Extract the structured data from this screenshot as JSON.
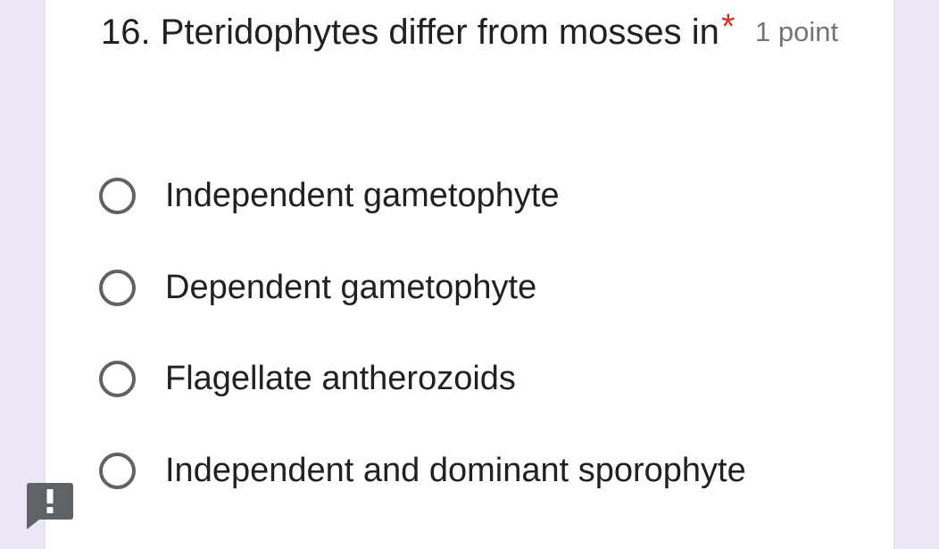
{
  "question": {
    "title": "16. Pteridophytes differ from mosses in",
    "required_marker": "*",
    "points_label": "1 point"
  },
  "options": [
    {
      "label": "Independent gametophyte"
    },
    {
      "label": "Dependent gametophyte"
    },
    {
      "label": "Flagellate antherozoids"
    },
    {
      "label": "Independent and dominant sporophyte"
    }
  ],
  "icons": {
    "report": "exclamation-feedback-icon"
  },
  "colors": {
    "page_background": "#ece6f6",
    "card_background": "#ffffff",
    "required_star": "#d93025",
    "radio_border": "#5f6368",
    "report_badge": "#5f6368"
  }
}
